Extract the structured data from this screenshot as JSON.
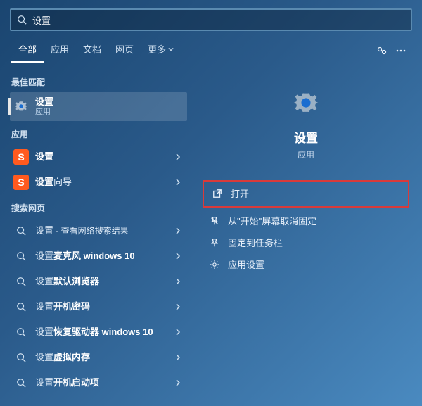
{
  "search": {
    "query": "设置"
  },
  "tabs": [
    "全部",
    "应用",
    "文档",
    "网页",
    "更多"
  ],
  "sections": {
    "best": "最佳匹配",
    "apps": "应用",
    "web": "搜索网页"
  },
  "bestMatch": {
    "title": "设置",
    "subtitle": "应用"
  },
  "appResults": [
    {
      "title": "设置"
    },
    {
      "title": "设置",
      "suffix": "向导"
    }
  ],
  "webResults": [
    {
      "bold": "",
      "normal": "设置",
      "trail": " - 查看网络搜索结果"
    },
    {
      "bold": "麦克风 windows 10",
      "prefix": "设置"
    },
    {
      "bold": "默认浏览器",
      "prefix": "设置"
    },
    {
      "bold": "开机密码",
      "prefix": "设置"
    },
    {
      "bold": "恢复驱动器 windows 10",
      "prefix": "设置"
    },
    {
      "bold": "虚拟内存",
      "prefix": "设置"
    },
    {
      "bold": "开机启动项",
      "prefix": "设置"
    }
  ],
  "detail": {
    "title": "设置",
    "subtitle": "应用",
    "actions": [
      {
        "icon": "open",
        "label": "打开"
      },
      {
        "icon": "unpin",
        "label": "从\"开始\"屏幕取消固定"
      },
      {
        "icon": "pin-taskbar",
        "label": "固定到任务栏"
      },
      {
        "icon": "gear",
        "label": "应用设置"
      }
    ]
  }
}
